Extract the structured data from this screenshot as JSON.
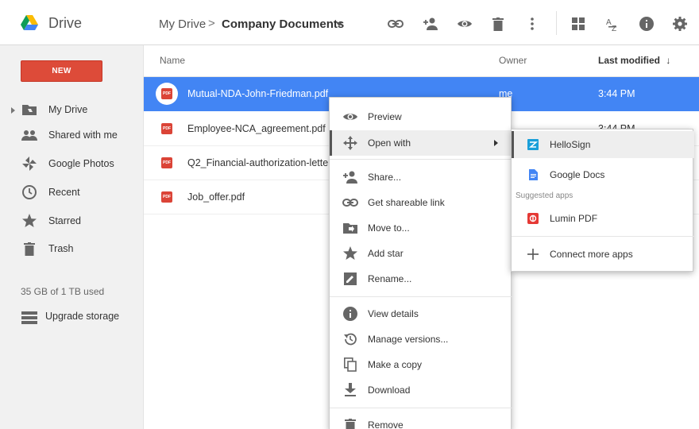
{
  "header": {
    "app_name": "Drive",
    "breadcrumb_root": "My Drive",
    "breadcrumb_separator": ">",
    "breadcrumb_current": "Company Documents",
    "toolbar_icons": [
      "link-icon",
      "add-person-icon",
      "preview-eye-icon",
      "trash-icon",
      "more-vert-icon",
      "grid-view-icon",
      "sort-az-icon",
      "info-icon",
      "settings-gear-icon"
    ]
  },
  "sidebar": {
    "new_label": "NEW",
    "items": [
      {
        "label": "My Drive",
        "icon": "folder-drive-icon"
      },
      {
        "label": "Shared with me",
        "icon": "people-icon"
      },
      {
        "label": "Google Photos",
        "icon": "pinwheel-icon"
      },
      {
        "label": "Recent",
        "icon": "clock-icon"
      },
      {
        "label": "Starred",
        "icon": "star-icon"
      },
      {
        "label": "Trash",
        "icon": "trash-icon"
      }
    ],
    "quota": "35 GB of 1 TB used",
    "upgrade_label": "Upgrade storage"
  },
  "list": {
    "col_name": "Name",
    "col_owner": "Owner",
    "col_modified": "Last modified",
    "sort_arrow": "↓",
    "rows": [
      {
        "name": "Mutual-NDA-John-Friedman.pdf",
        "owner": "me",
        "modified": "3:44 PM",
        "badge": "PDF"
      },
      {
        "name": "Employee-NCA_agreement.pdf",
        "owner": "",
        "modified": "3:44 PM",
        "badge": "PDF"
      },
      {
        "name": "Q2_Financial-authorization-letter.pdf",
        "owner": "",
        "modified": "",
        "badge": "PDF"
      },
      {
        "name": "Job_offer.pdf",
        "owner": "",
        "modified": "",
        "badge": "PDF"
      }
    ]
  },
  "context_menu": {
    "items": [
      {
        "label": "Preview",
        "icon": "eye-icon"
      },
      {
        "label": "Open with",
        "icon": "move-arrows-icon"
      },
      {
        "label": "Share...",
        "icon": "add-person-icon"
      },
      {
        "label": "Get shareable link",
        "icon": "link-icon"
      },
      {
        "label": "Move to...",
        "icon": "folder-move-icon"
      },
      {
        "label": "Add star",
        "icon": "star-icon"
      },
      {
        "label": "Rename...",
        "icon": "pencil-icon"
      },
      {
        "label": "View details",
        "icon": "info-icon"
      },
      {
        "label": "Manage versions...",
        "icon": "history-icon"
      },
      {
        "label": "Make a copy",
        "icon": "copy-icon"
      },
      {
        "label": "Download",
        "icon": "download-icon"
      },
      {
        "label": "Remove",
        "icon": "trash-icon"
      }
    ]
  },
  "open_with_menu": {
    "items": [
      {
        "label": "HelloSign",
        "icon": "hellosign-icon"
      },
      {
        "label": "Google Docs",
        "icon": "google-docs-icon"
      },
      {
        "label": "Lumin PDF",
        "icon": "lumin-pdf-icon"
      },
      {
        "label": "Connect more apps",
        "icon": "plus-icon"
      }
    ],
    "suggested_caption": "Suggested apps"
  },
  "colors": {
    "accent_blue": "#4285f4",
    "new_button_red": "#dd4b39",
    "pdf_red": "#db4437"
  }
}
